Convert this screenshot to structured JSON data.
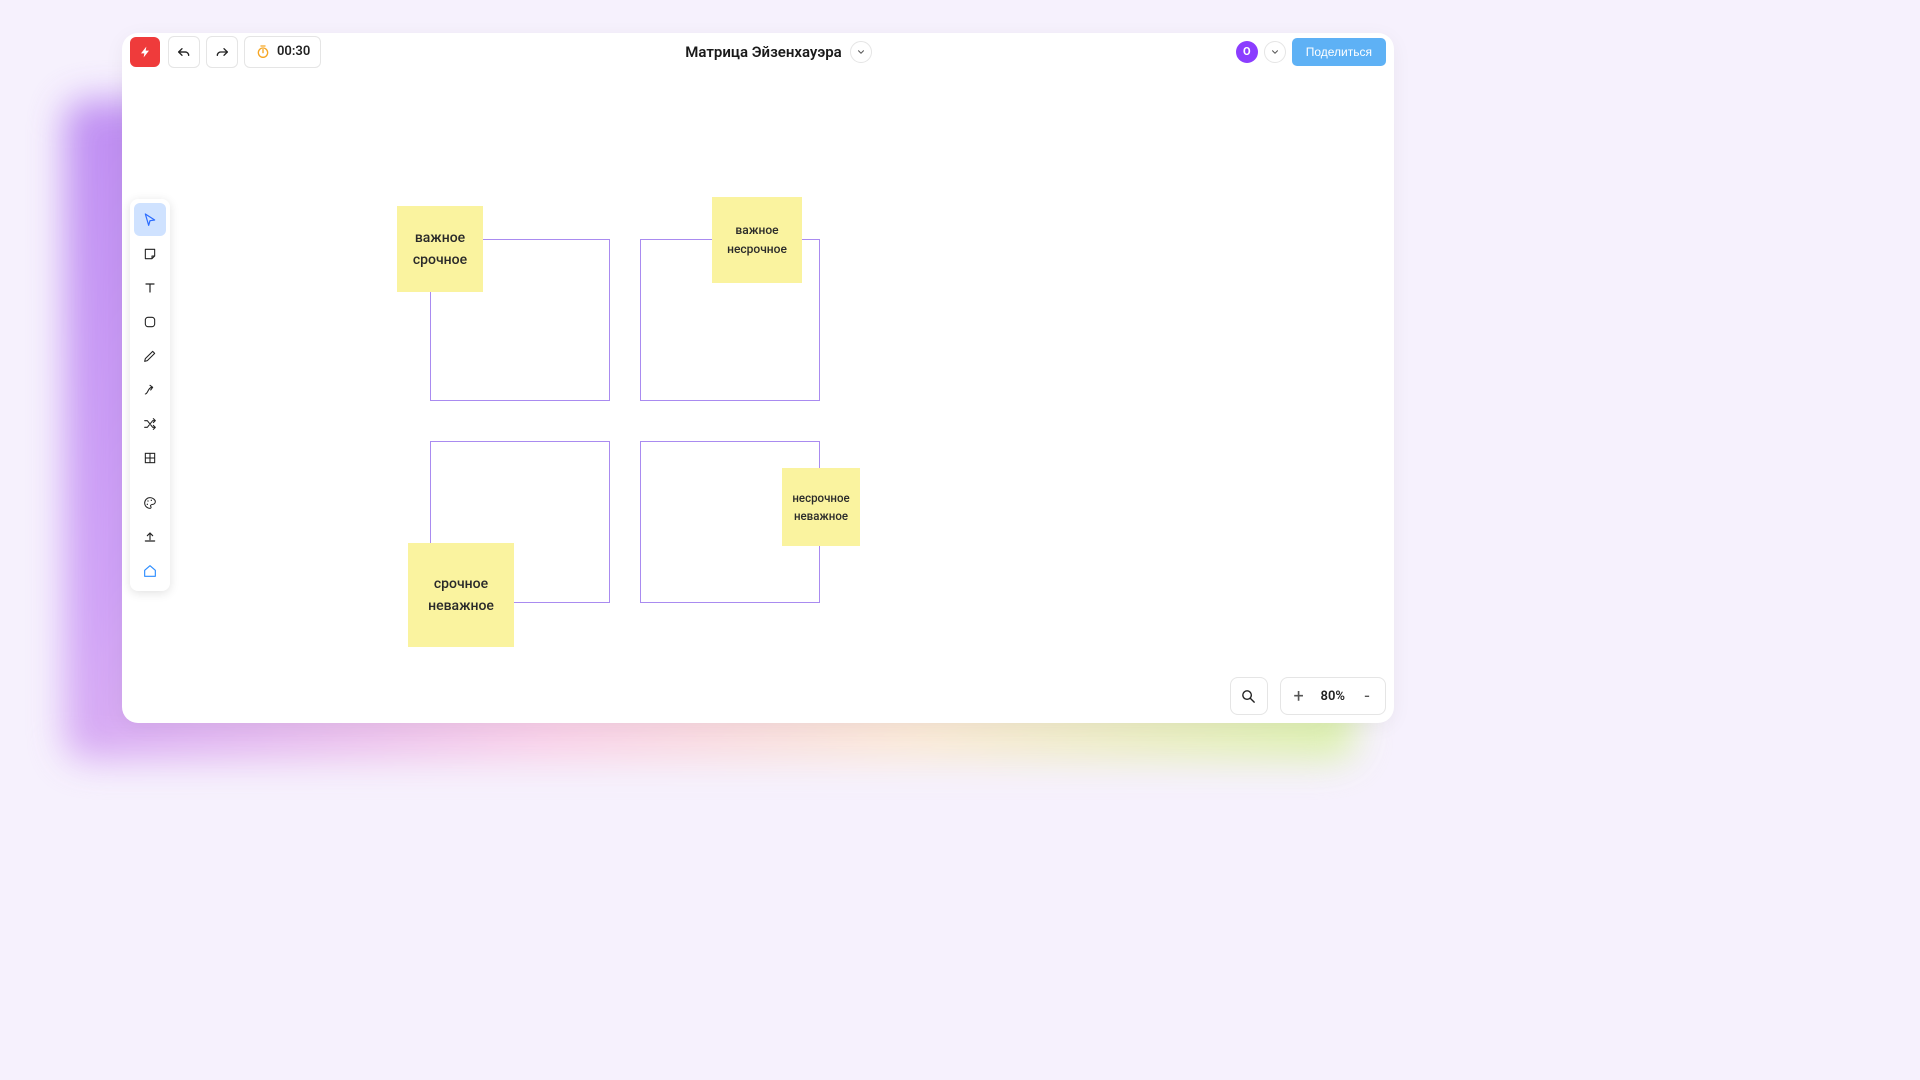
{
  "header": {
    "title": "Матрица Эйзенхауэра",
    "timer": "00:30",
    "avatar_initial": "О",
    "share_label": "Поделиться"
  },
  "zoom": {
    "level": "80%",
    "plus": "+",
    "minus": "-"
  },
  "stickies": {
    "q1_l1": "важное",
    "q1_l2": "срочное",
    "q2_l1": "важное",
    "q2_l2": "несрочное",
    "q3_l1": "срочное",
    "q3_l2": "неважное",
    "q4_l1": "несрочное",
    "q4_l2": "неважное"
  }
}
